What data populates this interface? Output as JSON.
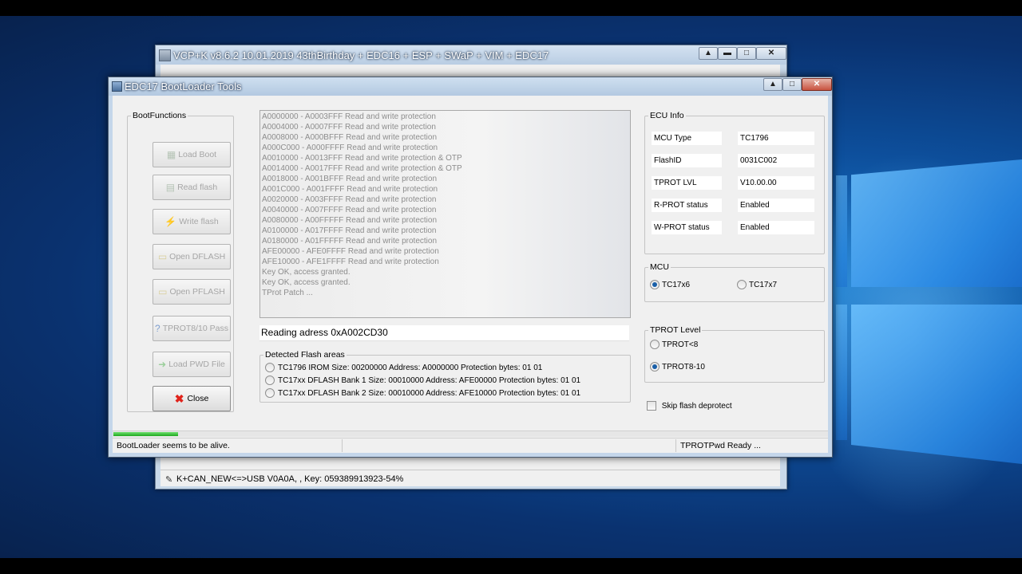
{
  "vcp_window": {
    "title": "VCP+K v8.6.2 10.01.2019 43thBirthday + EDC16 + ESP + SWaP + VIM + EDC17",
    "status_text": "K+CAN_NEW<=>USB V0A0A, , Key: 059389913923-54%"
  },
  "edc_window": {
    "title": "EDC17 BootLoader Tools",
    "boot_functions": {
      "legend": "BootFunctions",
      "buttons": [
        {
          "label": "Load Boot",
          "icon": "load-boot-icon"
        },
        {
          "label": "Read flash",
          "icon": "read-flash-icon"
        },
        {
          "label": "Write flash",
          "icon": "write-flash-icon"
        },
        {
          "label": "Open DFLASH",
          "icon": "folder-icon"
        },
        {
          "label": "Open PFLASH",
          "icon": "folder-icon"
        },
        {
          "label": "TPROT8/10 Pass",
          "icon": "help-icon"
        },
        {
          "label": "Load PWD File",
          "icon": "arrow-right-icon"
        }
      ],
      "close_label": "Close"
    },
    "log_lines": [
      "A0000000 - A0003FFF Read and write protection",
      "A0004000 - A0007FFF Read and write protection",
      "A0008000 - A000BFFF Read and write protection",
      "A000C000 - A000FFFF Read and write protection",
      "A0010000 - A0013FFF Read and write protection & OTP",
      "A0014000 - A0017FFF Read and write protection & OTP",
      "A0018000 - A001BFFF Read and write protection",
      "A001C000 - A001FFFF Read and write protection",
      "A0020000 - A003FFFF Read and write protection",
      "A0040000 - A007FFFF Read and write protection",
      "A0080000 - A00FFFFF Read and write protection",
      "A0100000 - A017FFFF Read and write protection",
      "A0180000 - A01FFFFF Read and write protection",
      "AFE00000 - AFE0FFFF Read and write protection",
      "AFE10000 - AFE1FFFF Read and write protection",
      "Key OK, access granted.",
      "Key OK, access granted.",
      "TProt Patch ..."
    ],
    "reading_text": "Reading adress 0xA002CD30",
    "detected_flash": {
      "legend": "Detected Flash areas",
      "rows": [
        "TC1796 IROM Size: 00200000 Address: A0000000 Protection bytes: 01 01",
        "TC17xx DFLASH Bank 1 Size: 00010000 Address: AFE00000 Protection bytes: 01 01",
        "TC17xx DFLASH Bank 2 Size: 00010000 Address: AFE10000 Protection bytes: 01 01"
      ]
    },
    "ecu_info": {
      "legend": "ECU Info",
      "rows": [
        {
          "key": "MCU Type",
          "value": "TC1796"
        },
        {
          "key": "FlashID",
          "value": "0031C002"
        },
        {
          "key": "TPROT LVL",
          "value": "V10.00.00"
        },
        {
          "key": "R-PROT status",
          "value": "Enabled"
        },
        {
          "key": "W-PROT status",
          "value": "Enabled"
        }
      ]
    },
    "mcu": {
      "legend": "MCU",
      "options": [
        "TC17x6",
        "TC17x7"
      ],
      "selected": "TC17x6"
    },
    "tprot_level": {
      "legend": "TPROT Level",
      "options": [
        "TPROT<8",
        "TPROT8-10"
      ],
      "selected": "TPROT8-10"
    },
    "skip_flash_deprotect": {
      "label": "Skip flash deprotect",
      "checked": false
    },
    "progress": 0.09,
    "status_left": "BootLoader seems to be alive.",
    "status_right": "TPROTPwd Ready ..."
  },
  "colors": {
    "desktop_blue": "#0d4f9c",
    "progress_green": "#1fa81f",
    "close_icon_red": "#e0231b"
  }
}
